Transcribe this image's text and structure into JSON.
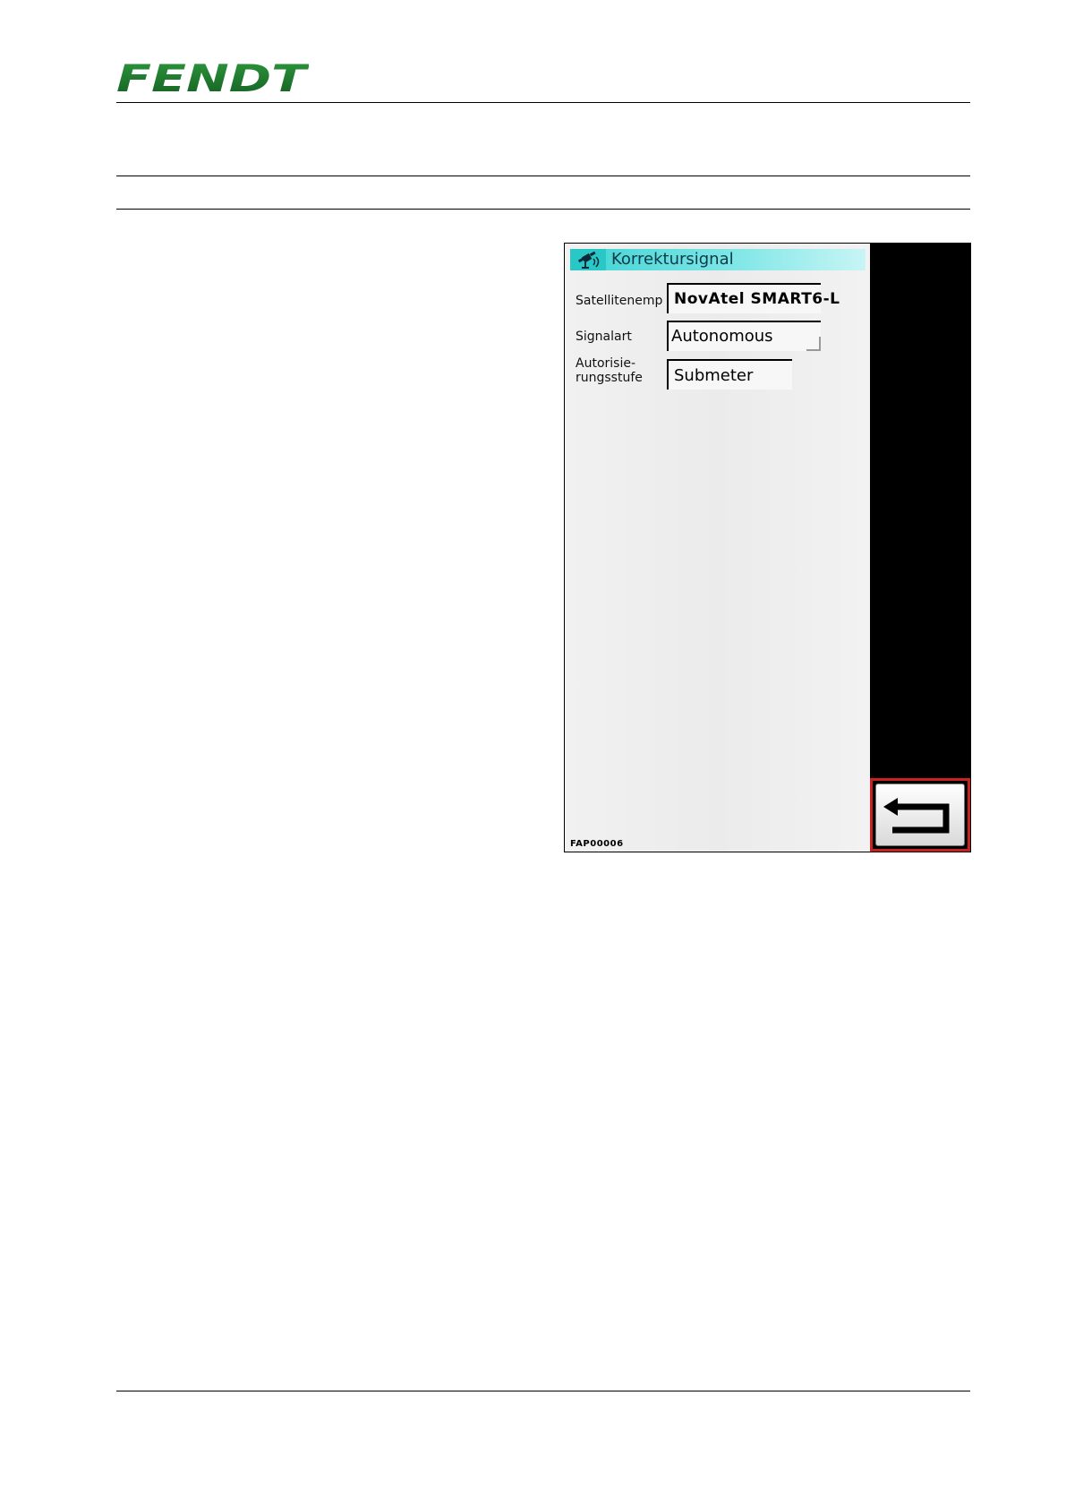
{
  "header": {
    "logo_text": "FENDT",
    "brand_color": "#1b7a2e"
  },
  "screen": {
    "title": "Korrektursignal",
    "fields": [
      {
        "label": "Satellitenemp",
        "value": "NovAtel SMART6-L"
      },
      {
        "label": "Signalart",
        "value": "Autonomous"
      },
      {
        "label_line1": "Autorisie-",
        "label_line2": "rungsstufe",
        "value": "Submeter"
      }
    ],
    "figure_code": "FAP00006",
    "back_button_icon": "return-arrow-icon"
  }
}
